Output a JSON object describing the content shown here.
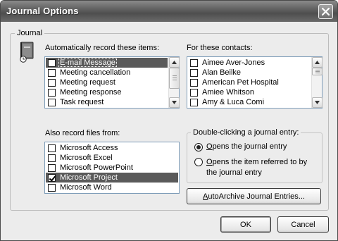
{
  "window": {
    "title": "Journal Options",
    "close_glyph": "×"
  },
  "journal_group": {
    "legend": "Journal"
  },
  "auto_record": {
    "label": "Automatically record these items:",
    "items": [
      {
        "label": "E-mail Message",
        "checked": false,
        "selected": true
      },
      {
        "label": "Meeting cancellation",
        "checked": false
      },
      {
        "label": "Meeting request",
        "checked": false
      },
      {
        "label": "Meeting response",
        "checked": false
      },
      {
        "label": "Task request",
        "checked": false
      }
    ]
  },
  "contacts": {
    "label": "For these contacts:",
    "items": [
      {
        "label": "Aimee Aver-Jones",
        "checked": false
      },
      {
        "label": "Alan Beilke",
        "checked": false
      },
      {
        "label": "American Pet Hospital",
        "checked": false
      },
      {
        "label": "Amiee Whitson",
        "checked": false
      },
      {
        "label": "Amy & Luca Comi",
        "checked": false
      }
    ]
  },
  "files": {
    "label": "Also record files from:",
    "items": [
      {
        "label": "Microsoft Access",
        "checked": false
      },
      {
        "label": "Microsoft Excel",
        "checked": false
      },
      {
        "label": "Microsoft PowerPoint",
        "checked": false
      },
      {
        "label": "Microsoft Project",
        "checked": true,
        "selected": true
      },
      {
        "label": "Microsoft Word",
        "checked": false
      }
    ]
  },
  "double_click": {
    "legend": "Double-clicking a journal entry:",
    "option1_prefix": "O",
    "option1_rest": "pens the journal entry",
    "option2_prefix": "O",
    "option2_rest": "pens the item referred to by",
    "option2_line2": "the journal entry",
    "selected": 1
  },
  "buttons": {
    "autoarchive_prefix": "A",
    "autoarchive_rest": "utoArchive Journal Entries...",
    "ok": "OK",
    "cancel": "Cancel"
  },
  "colors": {
    "titlebar": "#5c5c5c",
    "dialog_bg": "#ececec",
    "selection": "#5a5a5a"
  },
  "icons": {
    "journal": "journal-book-clock-icon",
    "close": "close-x-icon",
    "scroll_up": "arrow-up-icon",
    "scroll_down": "arrow-down-icon"
  }
}
